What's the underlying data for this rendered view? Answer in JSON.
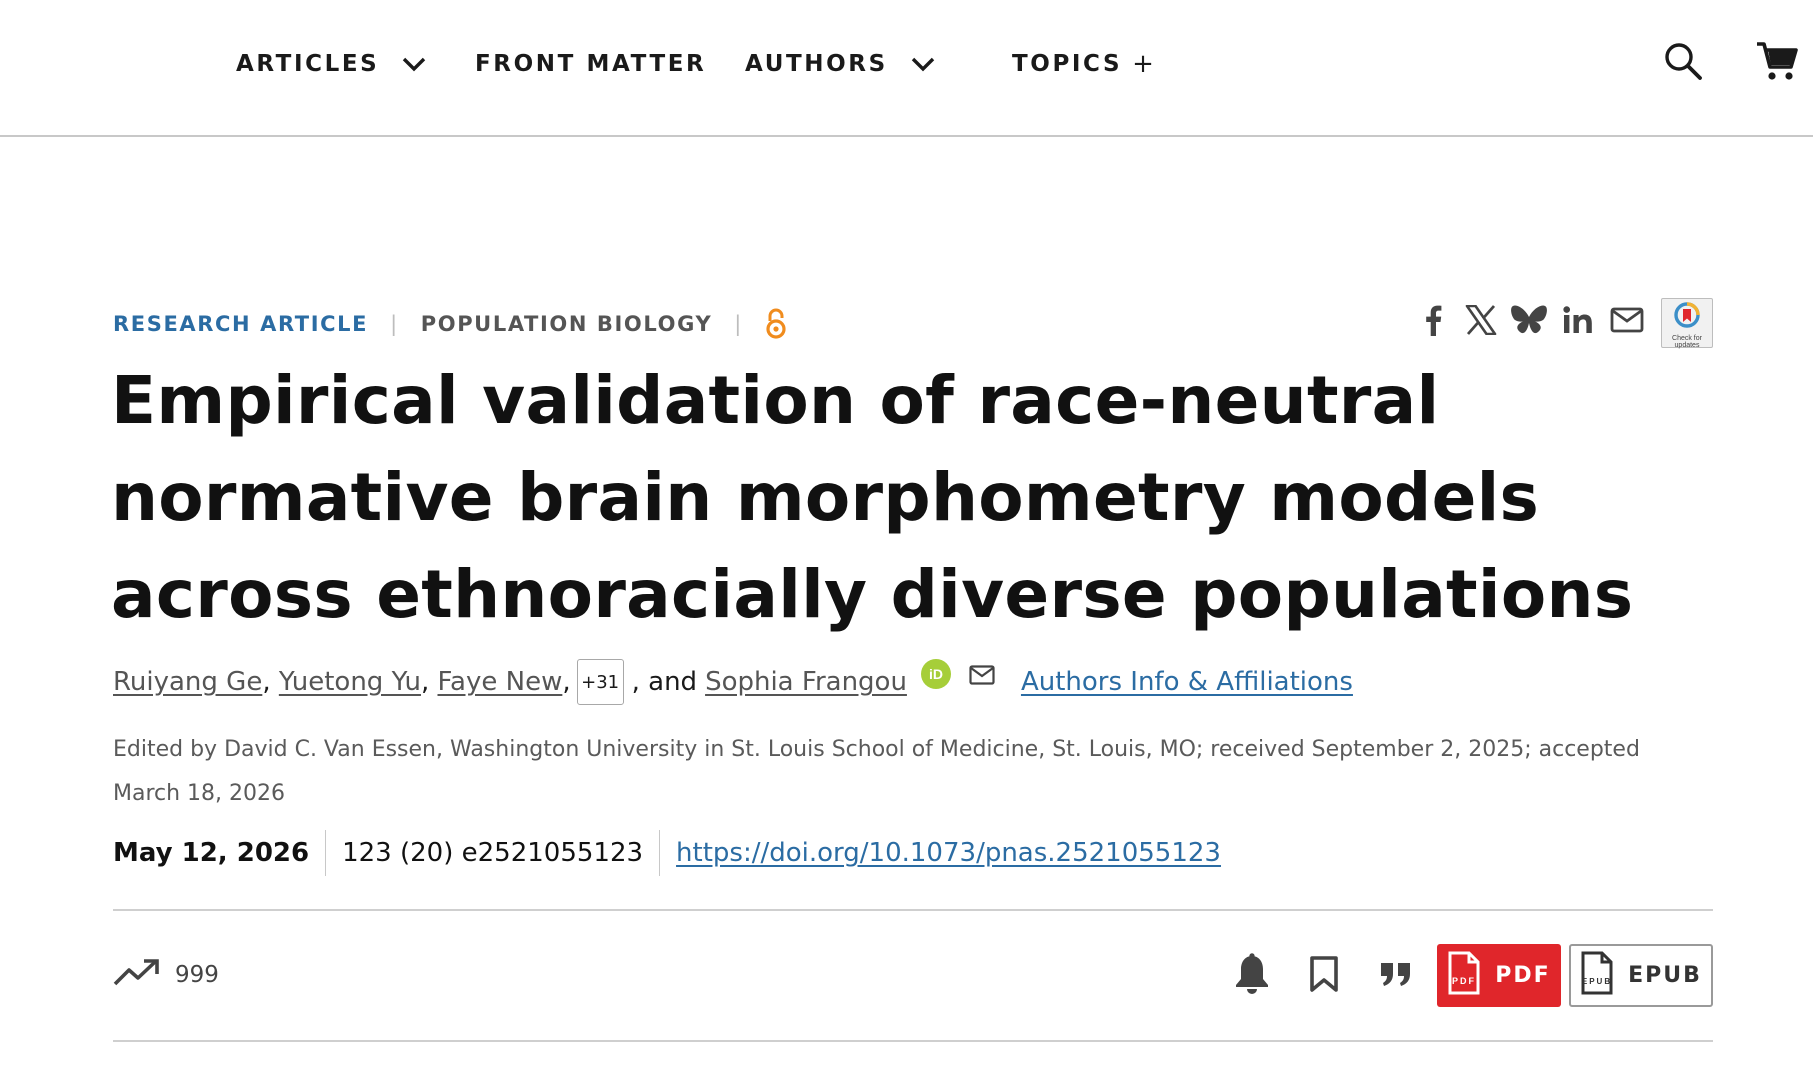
{
  "nav": {
    "articles": "ARTICLES",
    "front_matter": "FRONT MATTER",
    "authors": "AUTHORS",
    "topics": "TOPICS",
    "topics_plus": "+"
  },
  "article": {
    "type": "RESEARCH ARTICLE",
    "topic": "POPULATION BIOLOGY",
    "separator": "|",
    "title": "Empirical validation of race-neutral normative brain morphometry models across ethnoracially diverse populations",
    "authors": [
      {
        "name": "Ruiyang Ge",
        "after": ", "
      },
      {
        "name": "Yuetong Yu",
        "after": ", "
      },
      {
        "name": "Faye New",
        "after": ","
      }
    ],
    "more_authors": "+31",
    "and_text": ", and",
    "last_author": "Sophia Frangou",
    "orcid_label": "iD",
    "affiliations_link": "Authors Info & Affiliations",
    "edited_by": "Edited by David C. Van Essen, Washington University in St. Louis School of Medicine, St. Louis, MO; received September 2, 2025; accepted March 18, 2026",
    "pub_date": "May 12, 2026",
    "volume": "123 (20) e2521055123",
    "doi": "https://doi.org/10.1073/pnas.2521055123"
  },
  "crossmark": {
    "label": "Check for updates"
  },
  "toolbar": {
    "metric_value": "999",
    "pdf_label": "PDF",
    "epub_label": "EPUB",
    "pdf_icon_text": "PDF",
    "epub_icon_text": "EPUB"
  },
  "colors": {
    "accent_blue": "#2b6ca3",
    "pdf_red": "#e0262b",
    "oa_orange": "#f08c1e",
    "orcid_green": "#a6ce39"
  }
}
